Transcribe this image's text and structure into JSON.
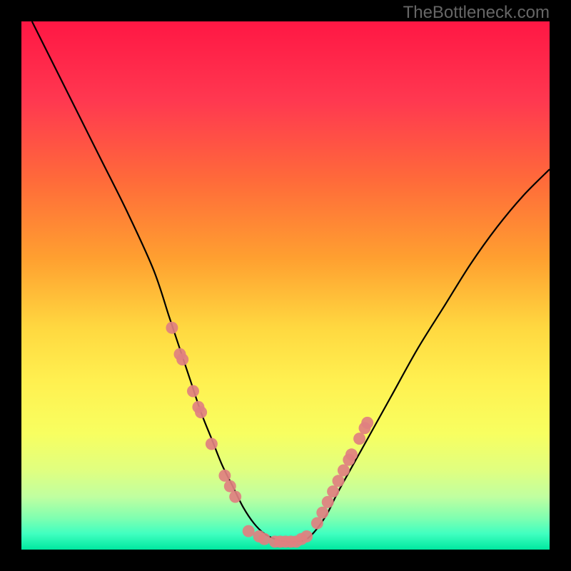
{
  "watermark": "TheBottleneck.com",
  "chart_data": {
    "type": "line",
    "title": "",
    "xlabel": "",
    "ylabel": "",
    "xlim": [
      0,
      100
    ],
    "ylim": [
      0,
      100
    ],
    "curve": {
      "x": [
        2,
        5,
        10,
        15,
        20,
        25,
        28,
        30,
        32,
        34,
        36,
        38,
        40,
        42,
        44,
        46,
        48,
        50,
        52,
        54,
        56,
        58,
        60,
        65,
        70,
        75,
        80,
        85,
        90,
        95,
        100
      ],
      "y": [
        100,
        94,
        84,
        74,
        64,
        53,
        44,
        38,
        32,
        26,
        21,
        16,
        12,
        8,
        5,
        3,
        2,
        1.5,
        1.5,
        2,
        4,
        7,
        11,
        20,
        29,
        38,
        46,
        54,
        61,
        67,
        72
      ]
    },
    "markers_left": {
      "x": [
        28.5,
        30,
        30.5,
        32.5,
        33.5,
        34,
        36,
        38.5,
        40.5,
        39.5
      ],
      "y": [
        42,
        37,
        36,
        30,
        27,
        26,
        20,
        14,
        10,
        12
      ],
      "color": "#e08080"
    },
    "markers_bottom": {
      "x": [
        43,
        45,
        46,
        48,
        49,
        50,
        51,
        52,
        53,
        54
      ],
      "y": [
        3.5,
        2.5,
        2,
        1.5,
        1.5,
        1.5,
        1.5,
        1.5,
        2,
        2.5
      ],
      "color": "#e08080"
    },
    "markers_right": {
      "x": [
        56,
        57,
        58,
        59,
        60,
        61,
        62,
        62.5,
        64,
        65,
        65.5
      ],
      "y": [
        5,
        7,
        9,
        11,
        13,
        15,
        17,
        18,
        21,
        23,
        24
      ],
      "color": "#e08080"
    },
    "gradient_stops": [
      {
        "offset": 0,
        "color": "#ff1744"
      },
      {
        "offset": 15,
        "color": "#ff3850"
      },
      {
        "offset": 30,
        "color": "#ff6a3a"
      },
      {
        "offset": 45,
        "color": "#ffa030"
      },
      {
        "offset": 58,
        "color": "#ffd840"
      },
      {
        "offset": 68,
        "color": "#fff050"
      },
      {
        "offset": 78,
        "color": "#f8ff60"
      },
      {
        "offset": 85,
        "color": "#e0ff80"
      },
      {
        "offset": 90,
        "color": "#c0ffa0"
      },
      {
        "offset": 94,
        "color": "#80ffb0"
      },
      {
        "offset": 97,
        "color": "#40ffc0"
      },
      {
        "offset": 100,
        "color": "#00e8a0"
      }
    ]
  }
}
